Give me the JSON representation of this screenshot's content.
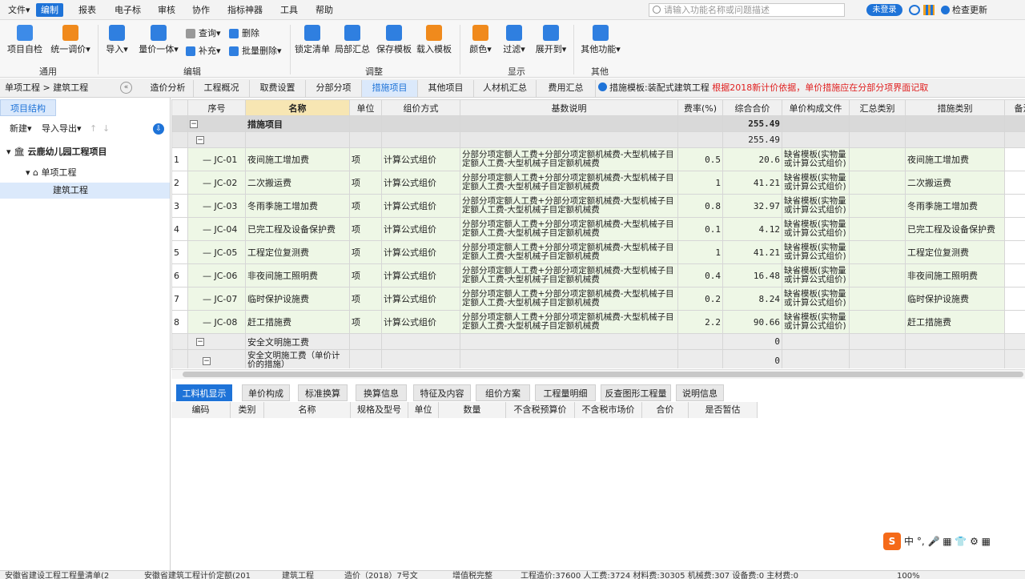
{
  "menu": {
    "items": [
      "文件▾",
      "编制",
      "报表",
      "电子标",
      "审核",
      "协作",
      "指标神器",
      "工具",
      "帮助"
    ],
    "search_placeholder": "请输入功能名称或问题描述",
    "login_label": "未登录",
    "check_update": "检查更新"
  },
  "ribbon": {
    "items": {
      "self_check": "项目自检",
      "unify_price": "统一调价▾",
      "import": "导入▾",
      "price_all": "量价一体▾",
      "query": "查询▾",
      "delete": "删除",
      "supplement": "补充▾",
      "batch_delete": "批量删除▾",
      "lock_list": "锁定清单",
      "partial_summary": "局部汇总",
      "save_template": "保存模板",
      "load_template": "载入模板",
      "color": "颜色▾",
      "filter": "过滤▾",
      "expand": "展开到▾",
      "other_func": "其他功能▾"
    },
    "groups": [
      "通用",
      "编辑",
      "调整",
      "显示",
      "其他"
    ]
  },
  "tabrow": {
    "breadcrumb": "单项工程 > 建筑工程",
    "tabs": [
      "造价分析",
      "工程概况",
      "取费设置",
      "分部分项",
      "措施项目",
      "其他项目",
      "人材机汇总",
      "费用汇总"
    ],
    "active_tab": "措施项目",
    "notice_template": "措施模板:装配式建筑工程",
    "notice_red": "根据2018新计价依据，单价措施应在分部分项界面记取"
  },
  "left": {
    "tab": "项目结构",
    "new": "新建▾",
    "import_export": "导入导出▾",
    "project": "云鹿幼儿园工程项目",
    "single": "单项工程",
    "unit": "建筑工程"
  },
  "grid": {
    "headers": [
      "序号",
      "名称",
      "单位",
      "组价方式",
      "基数说明",
      "费率(%)",
      "综合合价",
      "单价构成文件",
      "汇总类别",
      "措施类别",
      "备注"
    ],
    "top_group": {
      "name": "措施项目",
      "total": "255.49"
    },
    "sub_group": {
      "total": "255.49"
    },
    "rows": [
      {
        "idx": "1",
        "code": "JC-01",
        "name": "夜间施工增加费",
        "unit": "项",
        "method": "计算公式组价",
        "base": "分部分项定额人工费+分部分项定额机械费-大型机械子目定额人工费-大型机械子目定额机械费",
        "rate": "0.5",
        "total": "20.6",
        "file": "缺省模板(实物量或计算公式组价)",
        "cat": "夜间施工增加费"
      },
      {
        "idx": "2",
        "code": "JC-02",
        "name": "二次搬运费",
        "unit": "项",
        "method": "计算公式组价",
        "base": "分部分项定额人工费+分部分项定额机械费-大型机械子目定额人工费-大型机械子目定额机械费",
        "rate": "1",
        "total": "41.21",
        "file": "缺省模板(实物量或计算公式组价)",
        "cat": "二次搬运费"
      },
      {
        "idx": "3",
        "code": "JC-03",
        "name": "冬雨季施工增加费",
        "unit": "项",
        "method": "计算公式组价",
        "base": "分部分项定额人工费+分部分项定额机械费-大型机械子目定额人工费-大型机械子目定额机械费",
        "rate": "0.8",
        "total": "32.97",
        "file": "缺省模板(实物量或计算公式组价)",
        "cat": "冬雨季施工增加费"
      },
      {
        "idx": "4",
        "code": "JC-04",
        "name": "已完工程及设备保护费",
        "unit": "项",
        "method": "计算公式组价",
        "base": "分部分项定额人工费+分部分项定额机械费-大型机械子目定额人工费-大型机械子目定额机械费",
        "rate": "0.1",
        "total": "4.12",
        "file": "缺省模板(实物量或计算公式组价)",
        "cat": "已完工程及设备保护费"
      },
      {
        "idx": "5",
        "code": "JC-05",
        "name": "工程定位复测费",
        "unit": "项",
        "method": "计算公式组价",
        "base": "分部分项定额人工费+分部分项定额机械费-大型机械子目定额人工费-大型机械子目定额机械费",
        "rate": "1",
        "total": "41.21",
        "file": "缺省模板(实物量或计算公式组价)",
        "cat": "工程定位复测费"
      },
      {
        "idx": "6",
        "code": "JC-06",
        "name": "非夜间施工照明费",
        "unit": "项",
        "method": "计算公式组价",
        "base": "分部分项定额人工费+分部分项定额机械费-大型机械子目定额人工费-大型机械子目定额机械费",
        "rate": "0.4",
        "total": "16.48",
        "file": "缺省模板(实物量或计算公式组价)",
        "cat": "非夜间施工照明费"
      },
      {
        "idx": "7",
        "code": "JC-07",
        "name": "临时保护设施费",
        "unit": "项",
        "method": "计算公式组价",
        "base": "分部分项定额人工费+分部分项定额机械费-大型机械子目定额人工费-大型机械子目定额机械费",
        "rate": "0.2",
        "total": "8.24",
        "file": "缺省模板(实物量或计算公式组价)",
        "cat": "临时保护设施费"
      },
      {
        "idx": "8",
        "code": "JC-08",
        "name": "赶工措施费",
        "unit": "项",
        "method": "计算公式组价",
        "base": "分部分项定额人工费+分部分项定额机械费-大型机械子目定额人工费-大型机械子目定额机械费",
        "rate": "2.2",
        "total": "90.66",
        "file": "缺省模板(实物量或计算公式组价)",
        "cat": "赶工措施费"
      }
    ],
    "safety": {
      "name": "安全文明施工费",
      "total": "0"
    },
    "safety_sub": {
      "name": "安全文明施工费（单价计价的措施）",
      "total": "0"
    }
  },
  "bottom": {
    "tabs": [
      "工料机显示",
      "单价构成",
      "标准换算",
      "换算信息",
      "特征及内容",
      "组价方案",
      "工程量明细",
      "反查图形工程量",
      "说明信息"
    ],
    "headers": [
      "编码",
      "类别",
      "名称",
      "规格及型号",
      "单位",
      "数量",
      "不含税预算价",
      "不含税市场价",
      "合价",
      "是否暂估"
    ]
  },
  "ime": {
    "label": "中 °, 🎤 ▦ 👕 ⚙ ▦"
  },
  "status": {
    "items": [
      "安徽省建设工程工程量清单(2",
      "安徽省建筑工程计价定额(201",
      "建筑工程",
      "造价（2018）7号文",
      "增值税完整",
      "工程造价:37600 人工费:3724 材料费:30305 机械费:307 设备费:0 主材费:0",
      "100%"
    ]
  }
}
